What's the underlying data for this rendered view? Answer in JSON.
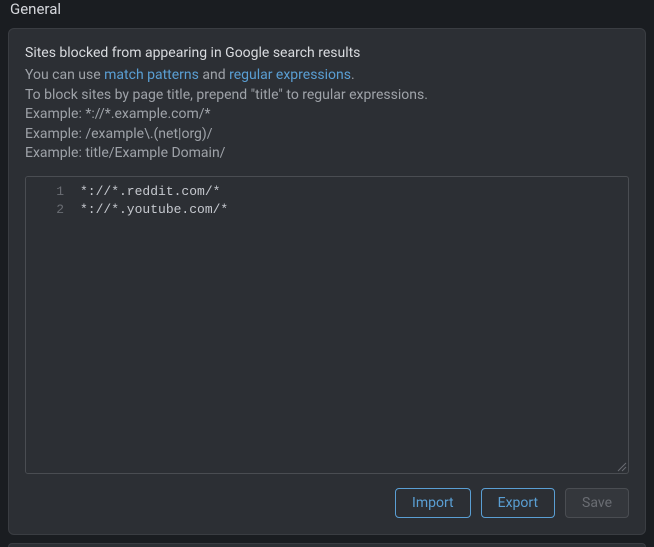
{
  "page": {
    "title": "General"
  },
  "panel": {
    "heading": "Sites blocked from appearing in Google search results",
    "desc": {
      "prefix": "You can use ",
      "link1": "match patterns",
      "mid": " and ",
      "link2": "regular expressions",
      "suffix": "."
    },
    "instruction": "To block sites by page title, prepend \"title\" to regular expressions.",
    "example1": "Example: *://*.example.com/*",
    "example2": "Example: /example\\.(net|org)/",
    "example3": "Example: title/Example Domain/"
  },
  "editor": {
    "lines": [
      "*://*.reddit.com/*",
      "*://*.youtube.com/*"
    ]
  },
  "buttons": {
    "import": "Import",
    "export": "Export",
    "save": "Save"
  }
}
